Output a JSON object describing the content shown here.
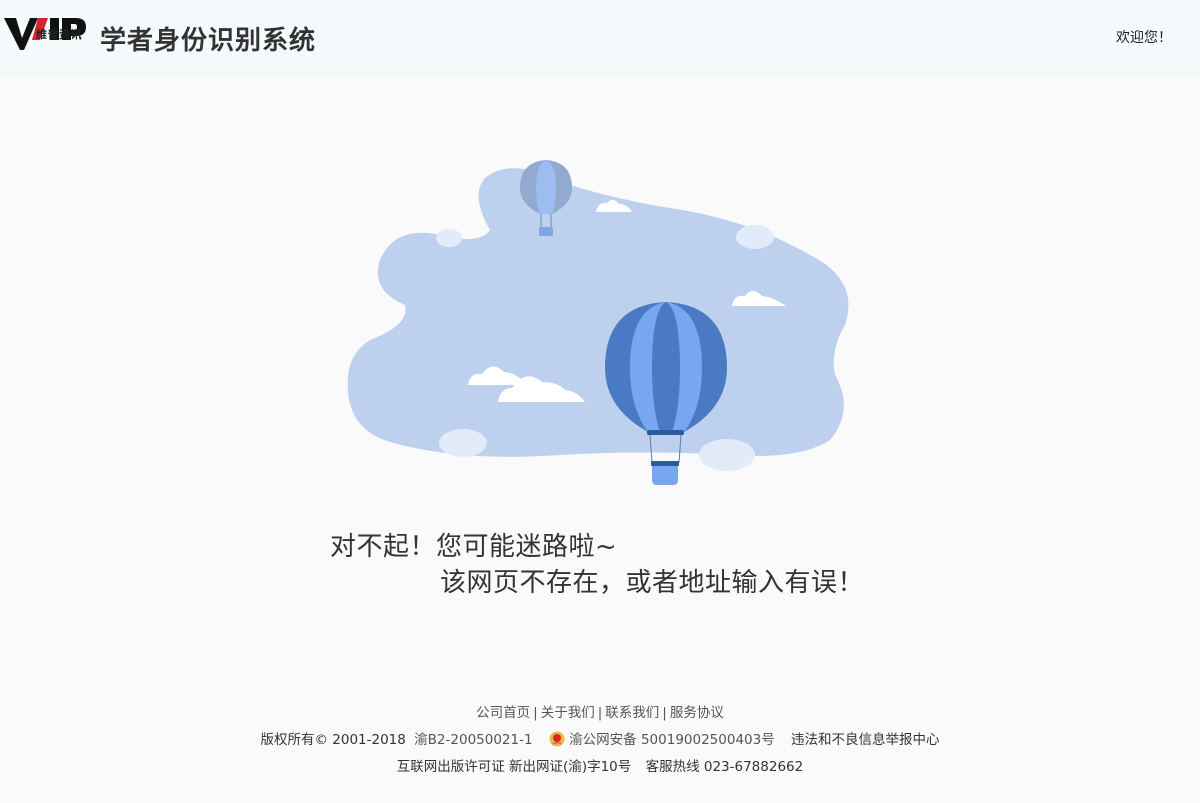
{
  "header": {
    "logo_caption": "维普资讯",
    "system_title": "学者身份识别系统",
    "welcome": "欢迎您！"
  },
  "error": {
    "line1": "对不起！您可能迷路啦~",
    "line2": "该网页不存在，或者地址输入有误！"
  },
  "footer": {
    "links": [
      "公司首页",
      "关于我们",
      "联系我们",
      "服务协议"
    ],
    "separator": "|",
    "copyright": "版权所有© 2001-2018",
    "icp": "渝B2-20050021-1",
    "police_record": "渝公网安备 50019002500403号",
    "report": "违法和不良信息举报中心",
    "publish_license": "互联网出版许可证 新出网证(渝)字10号",
    "hotline": "客服热线 023-67882662"
  },
  "colors": {
    "blob": "#bdd0ee",
    "balloon_dark": "#4a7ac4",
    "balloon_light": "#79a7ef",
    "cloud": "#e2ebf8"
  }
}
